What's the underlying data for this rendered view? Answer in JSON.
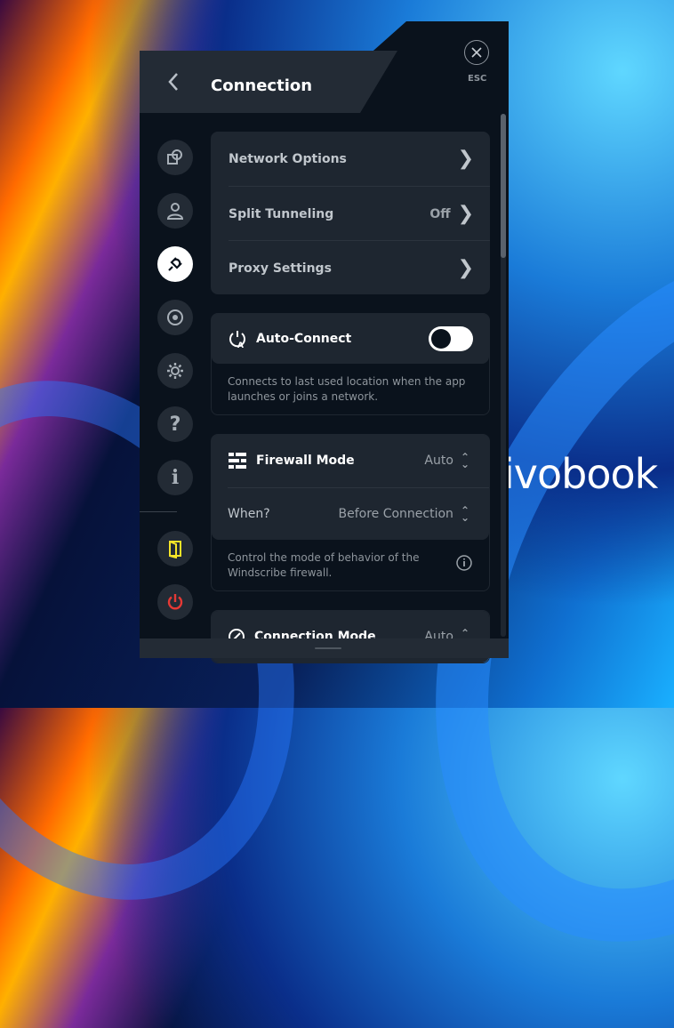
{
  "desktop": {
    "brand_text": "ivobook"
  },
  "header": {
    "title": "Connection",
    "back_icon": "chevron-left-icon",
    "close_icon": "close-icon",
    "esc_label": "ESC"
  },
  "sidebar": {
    "items": [
      {
        "name": "general",
        "icon": "preferences-icon"
      },
      {
        "name": "account",
        "icon": "user-icon"
      },
      {
        "name": "connection",
        "icon": "plug-icon",
        "active": true
      },
      {
        "name": "robert",
        "icon": "target-icon"
      },
      {
        "name": "advanced",
        "icon": "gear-icon"
      },
      {
        "name": "help",
        "icon": "question-icon"
      },
      {
        "name": "about",
        "icon": "info-icon"
      },
      {
        "name": "windscribe-logo",
        "icon": "door-icon"
      },
      {
        "name": "quit",
        "icon": "power-icon"
      }
    ]
  },
  "menu": {
    "network_options": "Network Options",
    "split_tunneling": "Split Tunneling",
    "split_tunneling_value": "Off",
    "proxy_settings": "Proxy Settings"
  },
  "auto_connect": {
    "label": "Auto-Connect",
    "enabled": true,
    "description": "Connects to last used location when the app launches or joins a network."
  },
  "firewall": {
    "label": "Firewall Mode",
    "value": "Auto",
    "when_label": "When?",
    "when_value": "Before Connection",
    "description": "Control the mode of behavior of the Windscribe firewall."
  },
  "connection_mode": {
    "label": "Connection Mode",
    "value": "Auto"
  },
  "colors": {
    "accent_yellow": "#f5e428",
    "power_red": "#e53935",
    "panel_bg": "#0a121c",
    "card_bg": "#1e2630"
  }
}
